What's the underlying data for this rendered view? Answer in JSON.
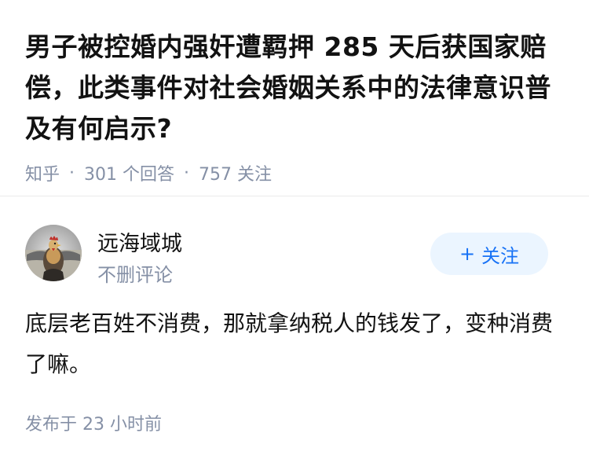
{
  "question": {
    "title": "男子被控婚内强奸遭羁押 285 天后获国家赔偿，此类事件对社会婚姻关系中的法律意识普及有何启示?",
    "source": "知乎",
    "separator": "·",
    "answer_count": "301 个回答",
    "follow_count": "757 关注"
  },
  "answer": {
    "author_name": "远海域城",
    "author_bio": "不删评论",
    "follow_label": "关注",
    "follow_icon": "plus-icon",
    "content": "底层老百姓不消费，那就拿纳税人的钱发了，变种消费了嘛。",
    "time": "发布于 23 小时前"
  },
  "colors": {
    "title": "#121212",
    "meta": "#8590a6",
    "accent": "#1772f6",
    "follow_bg": "#ebf5ff"
  }
}
